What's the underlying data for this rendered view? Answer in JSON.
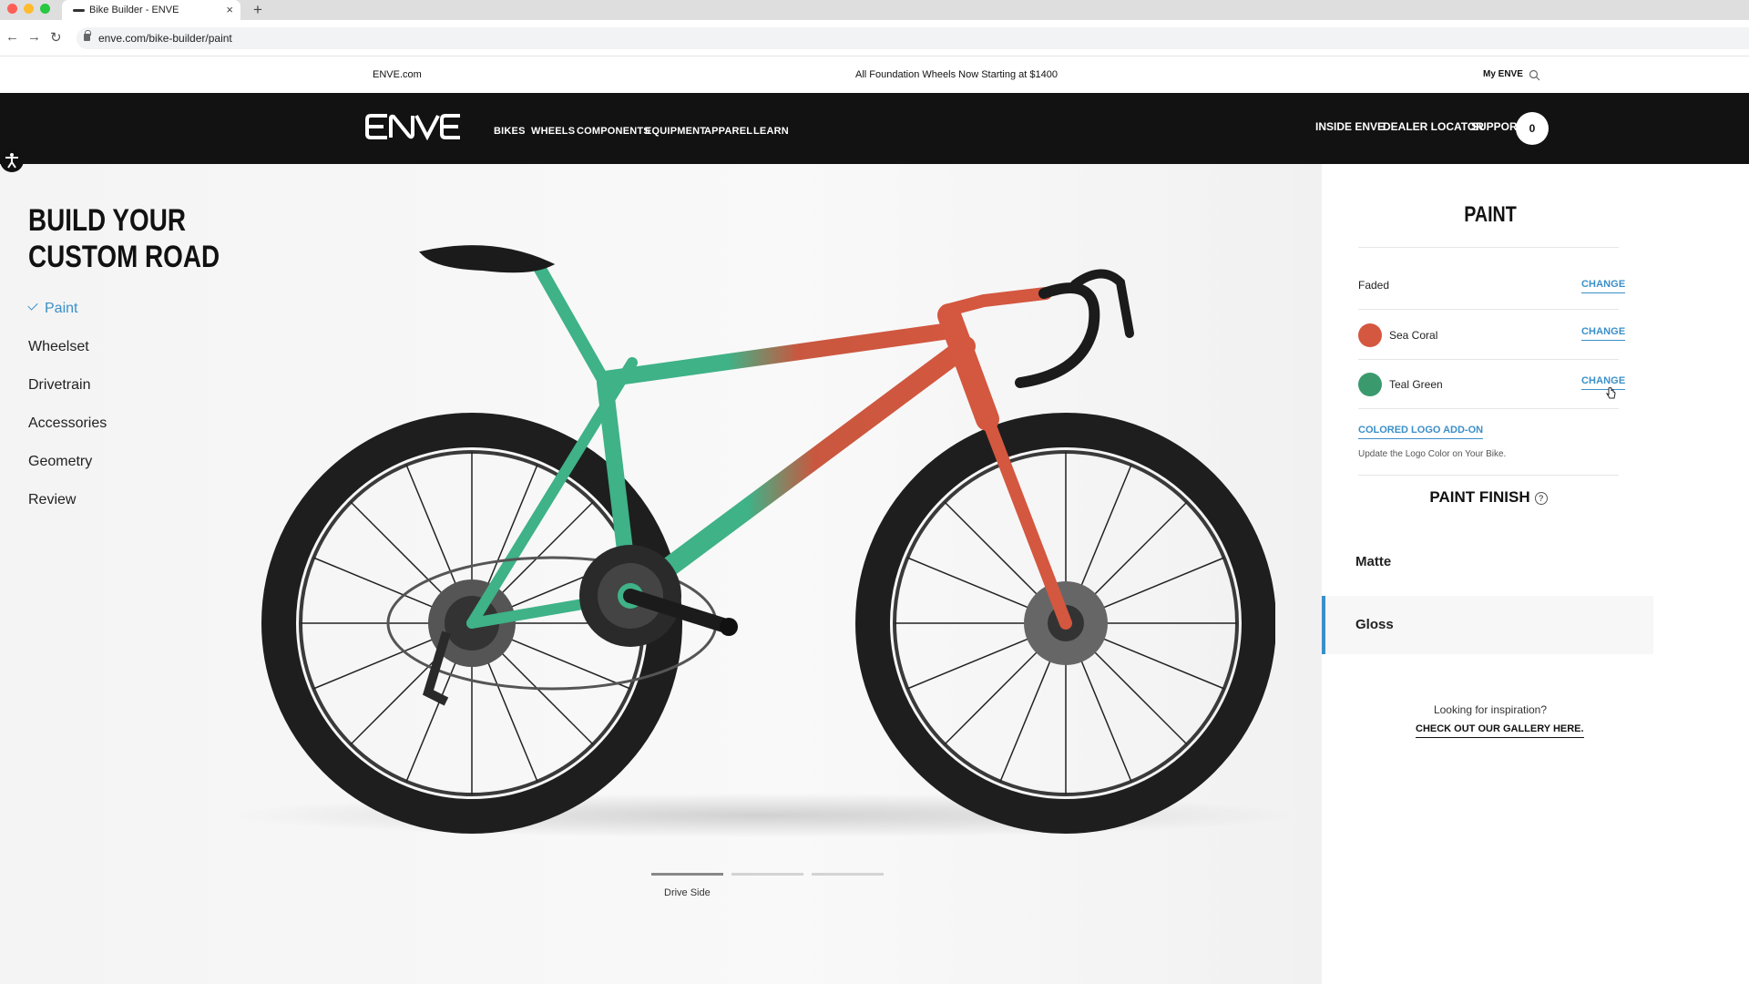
{
  "browser": {
    "tab_title": "Bike Builder - ENVE",
    "tab_close": "×",
    "new_tab": "+",
    "url": "enve.com/bike-builder/paint",
    "back": "←",
    "forward": "→",
    "reload": "↻"
  },
  "announcement": {
    "site_link": "ENVE.com",
    "promo": "All Foundation Wheels Now Starting at $1400",
    "account": "My ENVE"
  },
  "nav": {
    "items": [
      "BIKES",
      "WHEELS",
      "COMPONENTS",
      "EQUIPMENT",
      "APPAREL",
      "LEARN"
    ],
    "right": [
      "INSIDE ENVE",
      "DEALER LOCATOR",
      "SUPPORT"
    ],
    "cart_count": "0"
  },
  "builder": {
    "title_line1": "BUILD YOUR",
    "title_line2": "CUSTOM ROAD",
    "steps": [
      "Paint",
      "Wheelset",
      "Drivetrain",
      "Accessories",
      "Geometry",
      "Review"
    ],
    "active_step": "Paint",
    "view_label": "Drive Side",
    "view_index": 1,
    "view_count": 3
  },
  "panel": {
    "title": "PAINT",
    "scheme": {
      "label": "Faded",
      "change": "CHANGE"
    },
    "colors": [
      {
        "name": "Sea Coral",
        "hex": "#d4573f",
        "change": "CHANGE"
      },
      {
        "name": "Teal Green",
        "hex": "#3a9a6e",
        "change": "CHANGE"
      }
    ],
    "addon_label": "COLORED LOGO ADD-ON",
    "addon_desc": "Update the Logo Color on Your Bike.",
    "finish_title": "PAINT FINISH",
    "finish_help": "?",
    "finishes": [
      "Matte",
      "Gloss"
    ],
    "selected_finish": "Gloss",
    "inspiration": "Looking for inspiration?",
    "gallery_link": "CHECK OUT OUR GALLERY HERE."
  },
  "colors": {
    "accent": "#3a8fc9",
    "nav_bg": "#121212",
    "frame_green": "#3fb287",
    "frame_coral": "#d4573f"
  }
}
